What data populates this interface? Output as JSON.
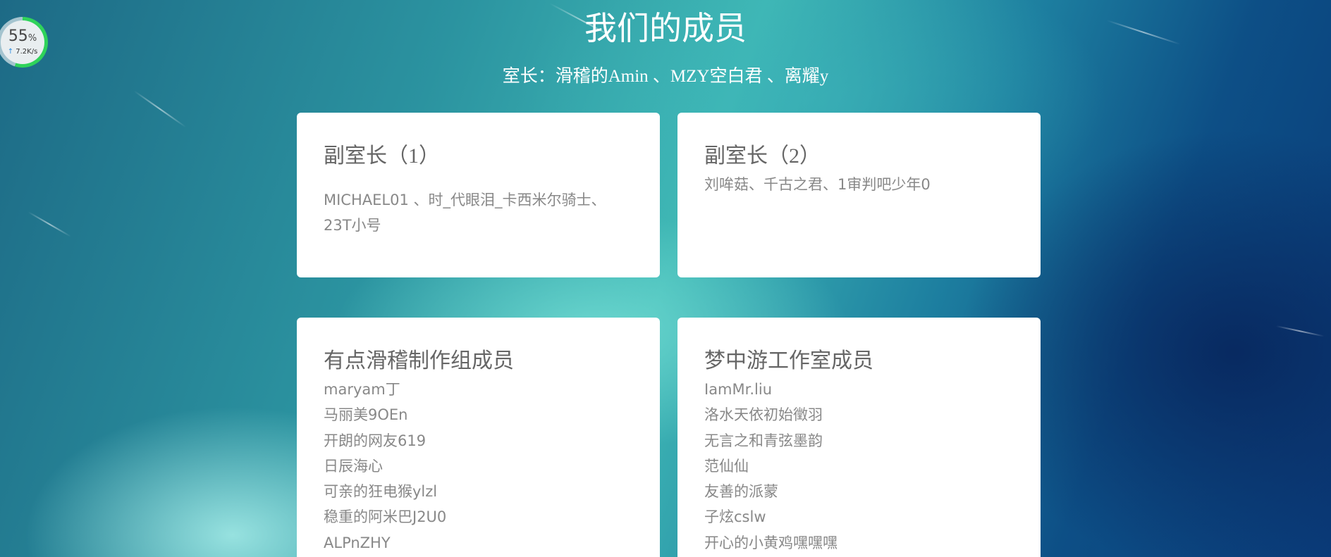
{
  "speed": {
    "percent": "55",
    "percent_unit": "%",
    "progress_fraction": 0.55,
    "rate": "7.2K/s",
    "accent": "#2fd35a"
  },
  "header": {
    "title": "我们的成员",
    "leaders": "室长：滑稽的Amin 、MZY空白君 、离耀y"
  },
  "cards": {
    "deputy1": {
      "title": "副室长",
      "title_num": "（1）",
      "text": "MICHAEL01 、时_代眼泪_卡西米尔骑士、23T小号"
    },
    "deputy2": {
      "title": "副室长",
      "title_num": "（2）",
      "text": "刘哞菇、千古之君、1审判吧少年0"
    },
    "group1": {
      "title": "有点滑稽制作组成员",
      "members": [
        "maryam丁",
        "马丽美9OEn",
        "开朗的网友619",
        "日辰海心",
        "可亲的狂电猴ylzl",
        "稳重的阿米巴J2U0",
        "ALPnZHY"
      ]
    },
    "group2": {
      "title": "梦中游工作室成员",
      "members": [
        "IamMr.liu",
        "洛水天依初始徵羽",
        "无言之和青弦墨韵",
        "范仙仙",
        "友善的派蒙",
        "子炫cslw",
        "开心的小黄鸡嘿嘿嘿"
      ]
    }
  }
}
